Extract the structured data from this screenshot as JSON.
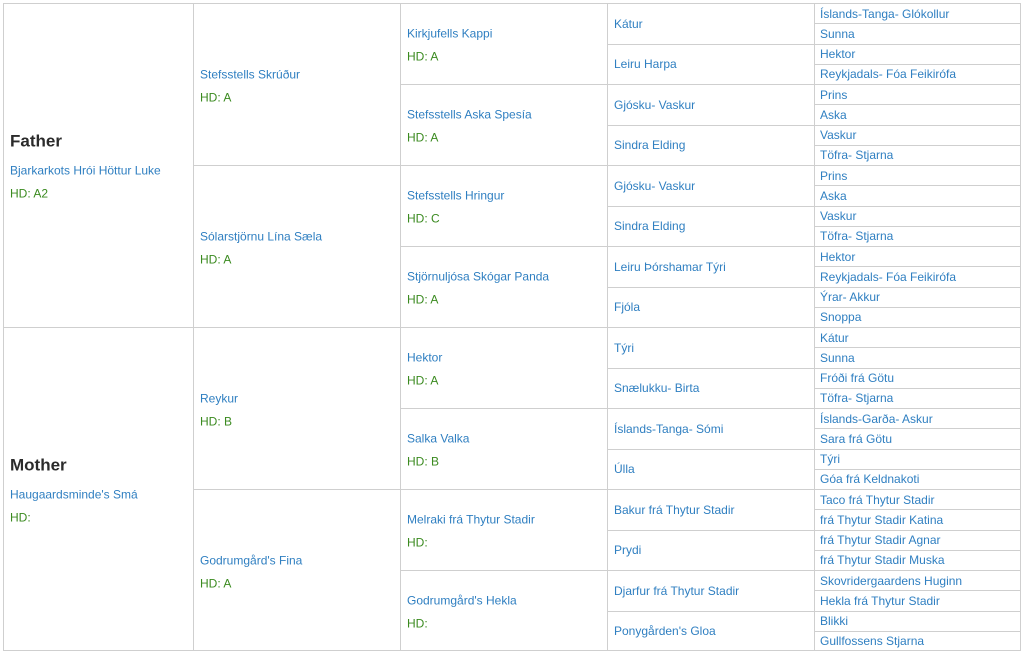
{
  "gen1": [
    {
      "role": "Father",
      "name": "Bjarkarkots Hrói Höttur Luke",
      "hd": "HD: A2"
    },
    {
      "role": "Mother",
      "name": "Haugaardsminde's Smá",
      "hd": "HD:"
    }
  ],
  "gen2": [
    {
      "name": "Stefsstells Skrúður",
      "hd": "HD: A"
    },
    {
      "name": "Sólarstjörnu Lína Sæla",
      "hd": "HD: A"
    },
    {
      "name": "Reykur",
      "hd": "HD: B"
    },
    {
      "name": "Godrumgård's Fina",
      "hd": "HD: A"
    }
  ],
  "gen3": [
    {
      "name": "Kirkjufells Kappi",
      "hd": "HD: A"
    },
    {
      "name": "Stefsstells Aska Spesía",
      "hd": "HD: A"
    },
    {
      "name": "Stefsstells Hringur",
      "hd": "HD: C"
    },
    {
      "name": "Stjörnuljósa Skógar Panda",
      "hd": "HD: A"
    },
    {
      "name": "Hektor",
      "hd": "HD: A"
    },
    {
      "name": "Salka Valka",
      "hd": "HD: B"
    },
    {
      "name": "Melraki frá Thytur Stadir",
      "hd": "HD:"
    },
    {
      "name": "Godrumgård's Hekla",
      "hd": "HD:"
    }
  ],
  "gen4": [
    {
      "name": "Kátur"
    },
    {
      "name": "Leiru Harpa"
    },
    {
      "name": "Gjósku- Vaskur"
    },
    {
      "name": "Sindra Elding"
    },
    {
      "name": "Gjósku- Vaskur"
    },
    {
      "name": "Sindra Elding"
    },
    {
      "name": "Leiru Þórshamar Týri"
    },
    {
      "name": "Fjóla"
    },
    {
      "name": "Týri"
    },
    {
      "name": "Snælukku- Birta"
    },
    {
      "name": "Íslands-Tanga- Sómi"
    },
    {
      "name": "Úlla"
    },
    {
      "name": "Bakur frá Thytur Stadir"
    },
    {
      "name": "Prydi"
    },
    {
      "name": "Djarfur frá Thytur Stadir"
    },
    {
      "name": "Ponygården's Gloa"
    }
  ],
  "gen5": [
    {
      "name": "Íslands-Tanga- Glókollur"
    },
    {
      "name": "Sunna"
    },
    {
      "name": "Hektor"
    },
    {
      "name": "Reykjadals- Fóa Feikirófa"
    },
    {
      "name": "Prins"
    },
    {
      "name": "Aska"
    },
    {
      "name": "Vaskur"
    },
    {
      "name": "Töfra- Stjarna"
    },
    {
      "name": "Prins"
    },
    {
      "name": "Aska"
    },
    {
      "name": "Vaskur"
    },
    {
      "name": "Töfra- Stjarna"
    },
    {
      "name": "Hektor"
    },
    {
      "name": "Reykjadals- Fóa Feikirófa"
    },
    {
      "name": "Ýrar- Akkur"
    },
    {
      "name": "Snoppa"
    },
    {
      "name": "Kátur"
    },
    {
      "name": "Sunna"
    },
    {
      "name": "Fróði frá Götu"
    },
    {
      "name": "Töfra- Stjarna"
    },
    {
      "name": "Íslands-Garða- Askur"
    },
    {
      "name": "Sara frá Götu"
    },
    {
      "name": "Týri"
    },
    {
      "name": "Góa frá Keldnakoti"
    },
    {
      "name": "Taco frá Thytur Stadir"
    },
    {
      "name": "frá Thytur Stadir Katina"
    },
    {
      "name": "frá Thytur Stadir Agnar"
    },
    {
      "name": "frá Thytur Stadir Muska"
    },
    {
      "name": "Skovridergaardens Huginn"
    },
    {
      "name": "Hekla frá Thytur Stadir"
    },
    {
      "name": "Blikki"
    },
    {
      "name": "Gullfossens Stjarna"
    }
  ]
}
